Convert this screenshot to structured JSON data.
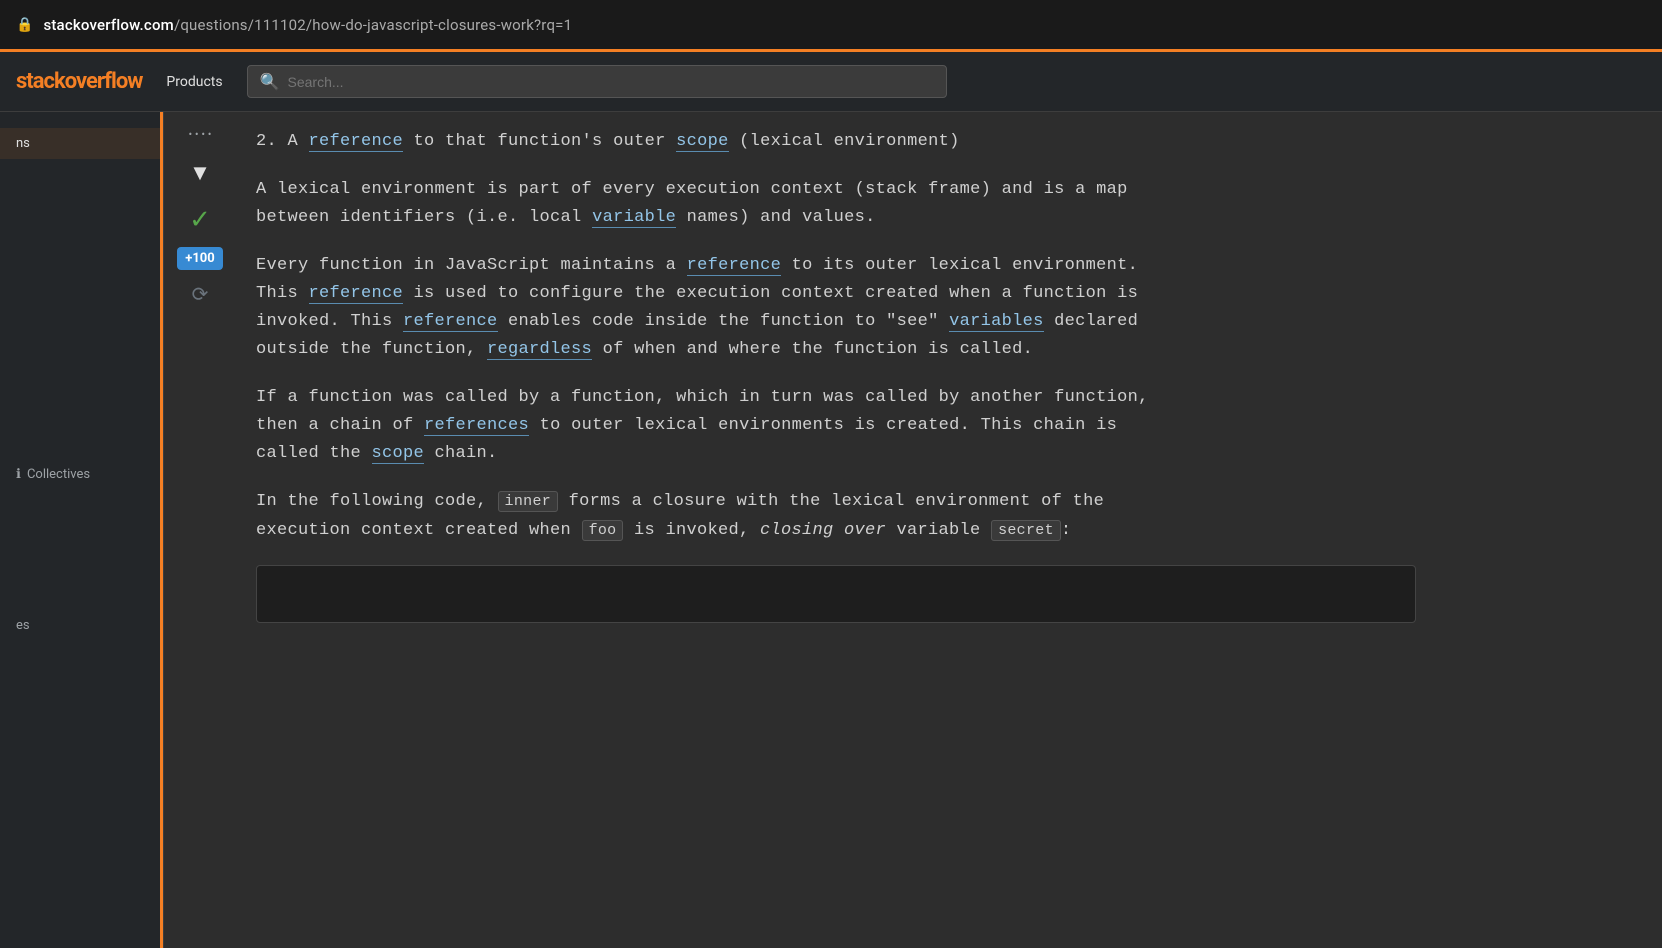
{
  "browser": {
    "lock_icon": "🔒",
    "url_domain": "stackoverflow.com",
    "url_path": "/questions/111102/how-do-javascript-closures-work?rq=1"
  },
  "header": {
    "logo_prefix": "",
    "logo_main": "overflow",
    "products_label": "Products",
    "search_placeholder": "Search..."
  },
  "sidebar": {
    "active_item": "ns",
    "items_visible": [
      "ns"
    ],
    "info_icon": "ℹ",
    "collectives_label": "Collectives",
    "bottom_label": "es"
  },
  "vote_area": {
    "score_dots": "• • • •",
    "bounty": "+100",
    "accepted": true
  },
  "answer": {
    "section_2_header": "2.  A reference to that function's outer scope (lexical environment)",
    "section_2_header_link1": "reference",
    "section_2_header_link2": "scope",
    "para1": "A lexical environment is part of every execution context (stack frame) and is a map between identifiers (i.e. local variable names) and values.",
    "para1_link": "variable",
    "para2_line1": "Every function in JavaScript maintains a reference to its outer lexical environment.",
    "para2_link1": "reference",
    "para2_line2": "This reference is used to configure the execution context created when a function is",
    "para2_link2": "reference",
    "para2_line3": "invoked. This reference enables code inside the function to \"see\" variables declared",
    "para2_link3": "reference",
    "para2_link4": "variables",
    "para2_line4": "outside the function, regardless of when and where the function is called.",
    "para2_link5": "regardless",
    "para3_line1": "If a function was called by a function, which in turn was called by another function,",
    "para3_line2": "then a chain of references to outer lexical environments is created. This chain is",
    "para3_link1": "references",
    "para3_line3": "called the scope chain.",
    "para3_link2": "scope",
    "para4_line1_prefix": "In the following code,",
    "para4_code1": "inner",
    "para4_line1_suffix": "forms a closure with the lexical environment of the",
    "para4_line2_prefix": "execution context created when",
    "para4_code2": "foo",
    "para4_line2_mid": "is invoked,",
    "para4_italic": "closing over",
    "para4_line2_suffix": "variable",
    "para4_code3": "secret",
    "para4_colon": ":"
  }
}
